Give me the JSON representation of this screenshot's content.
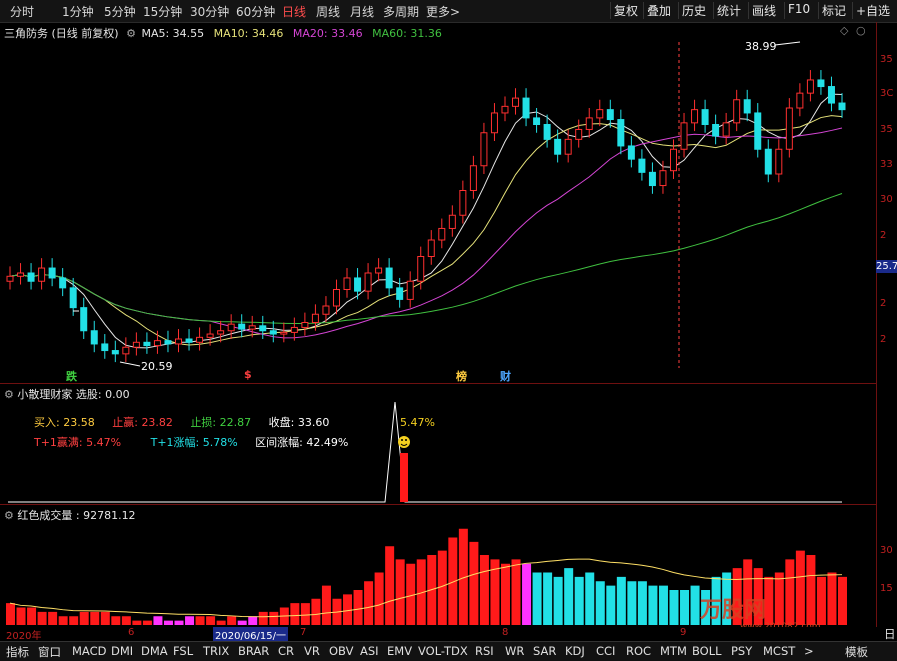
{
  "toolbar": {
    "periods": [
      "分时",
      "1分钟",
      "5分钟",
      "15分钟",
      "30分钟",
      "60分钟",
      "日线",
      "周线",
      "月线",
      "多周期",
      "更多"
    ],
    "active": "日线",
    "more_arrow": ">",
    "buttons": [
      "复权",
      "叠加",
      "历史",
      "统计",
      "画线",
      "F10",
      "标记",
      "+自选"
    ]
  },
  "main_panel": {
    "title": "三角防务 (日线 前复权)",
    "ma5": "MA5: 34.55",
    "ma10": "MA10: 34.46",
    "ma20": "MA20: 33.46",
    "ma60": "MA60: 31.36",
    "colors": {
      "ma5": "#e6e6e6",
      "ma10": "#e6e27a",
      "ma20": "#d445d4",
      "ma60": "#40c040",
      "up": "#ff3030",
      "down": "#22e0e6"
    },
    "high_label": "38.99",
    "low_label": "20.59",
    "current_price_tag": "25.7",
    "markers": [
      {
        "text": "跌",
        "color": "#40d040"
      },
      {
        "text": "$",
        "color": "#ff4040"
      },
      {
        "text": "榜",
        "color": "#ffcc40"
      },
      {
        "text": "财",
        "color": "#4da6ff"
      }
    ],
    "axis_labels": [
      "35",
      "3C",
      "35",
      "33",
      "30",
      "2",
      "2",
      "2"
    ]
  },
  "signal_panel": {
    "title": "小散理财家  选股: 0.00",
    "buy_label": "买入:",
    "buy_value": "23.58",
    "take_profit_label": "止赢:",
    "take_profit_value": "23.82",
    "stop_loss_label": "止损:",
    "stop_loss_value": "22.87",
    "close_label": "收盘:",
    "close_value": "33.60",
    "t1_winrate_label": "T+1赢满:",
    "t1_winrate_value": "5.47%",
    "t1_rise_label": "T+1涨幅:",
    "t1_rise_value": "5.78%",
    "range_rise_label": "区间涨幅:",
    "range_rise_value": "42.49%",
    "peak_label": "5.47%",
    "smile_icon": "smiley-face"
  },
  "volume_panel": {
    "title": "红色成交量 : 92781.12",
    "axis_labels": [
      "30",
      "15"
    ]
  },
  "date_axis": {
    "labels": [
      "2020年",
      "6",
      "2020/06/15/一",
      "7",
      "8",
      "9"
    ]
  },
  "bottombar": {
    "items": [
      "指标",
      "窗口",
      "MACD",
      "DMI",
      "DMA",
      "FSL",
      "TRIX",
      "BRAR",
      "CR",
      "VR",
      "OBV",
      "ASI",
      "EMV",
      "VOL-TDX",
      "RSI",
      "WR",
      "SAR",
      "KDJ",
      "CCI",
      "ROC",
      "MTM",
      "BOLL",
      "PSY",
      "MCST"
    ],
    "more_arrow": ">",
    "template": "模板",
    "right_label": "日"
  },
  "watermark": {
    "brand": "万股网",
    "url": "www.201082.com"
  }
}
